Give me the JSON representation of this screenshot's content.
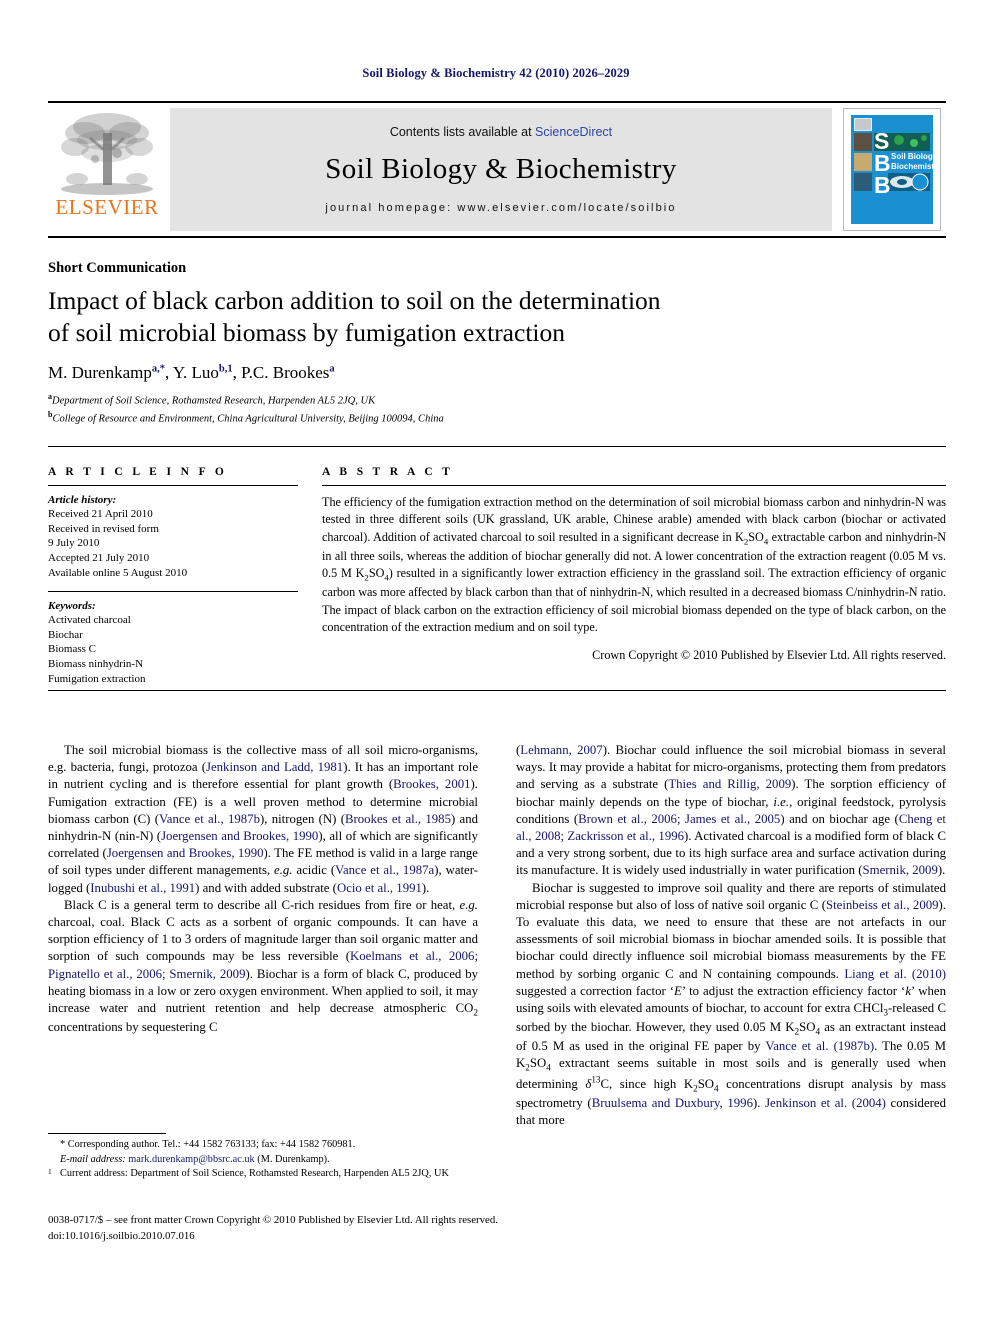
{
  "running_head": "Soil Biology & Biochemistry 42 (2010) 2026–2029",
  "masthead": {
    "publisher_name": "ELSEVIER",
    "publisher_logo": "elsevier-tree-logo",
    "contents_prefix": "Contents lists available at ",
    "contents_link": "ScienceDirect",
    "journal_title": "Soil Biology & Biochemistry",
    "homepage": "journal homepage: www.elsevier.com/locate/soilbio",
    "cover_alt": "SBB journal cover",
    "cover_letters": [
      "S",
      "B",
      "B"
    ],
    "cover_title_line1": "Soil Biology &",
    "cover_title_line2": "Biochemistry",
    "cover_color": "#1a8fd1"
  },
  "article": {
    "category": "Short Communication",
    "title_line1": "Impact of black carbon addition to soil on the determination",
    "title_line2": "of soil microbial biomass by fumigation extraction",
    "authors": [
      {
        "name": "M. Durenkamp",
        "sup": "a,*"
      },
      {
        "name": "Y. Luo",
        "sup": "b,1"
      },
      {
        "name": "P.C. Brookes",
        "sup": "a"
      }
    ],
    "affiliations": [
      {
        "mark": "a",
        "text": "Department of Soil Science, Rothamsted Research, Harpenden AL5 2JQ, UK"
      },
      {
        "mark": "b",
        "text": "College of Resource and Environment, China Agricultural University, Beijing 100094, China"
      }
    ]
  },
  "article_info": {
    "heading": "A R T I C L E   I N F O",
    "history_label": "Article history:",
    "history": [
      "Received 21 April 2010",
      "Received in revised form",
      "9 July 2010",
      "Accepted 21 July 2010",
      "Available online 5 August 2010"
    ],
    "keywords_label": "Keywords:",
    "keywords": [
      "Activated charcoal",
      "Biochar",
      "Biomass C",
      "Biomass ninhydrin-N",
      "Fumigation extraction"
    ]
  },
  "abstract": {
    "heading": "A B S T R A C T",
    "paragraph_parts": [
      "The efficiency of the fumigation extraction method on the determination of soil microbial biomass carbon and ninhydrin-N was tested in three different soils (UK grassland, UK arable, Chinese arable) amended with black carbon (biochar or activated charcoal). Addition of activated charcoal to soil resulted in a significant decrease in K",
      "2",
      "SO",
      "4",
      " extractable carbon and ninhydrin-N in all three soils, whereas the addition of biochar generally did not. A lower concentration of the extraction reagent (0.05 M vs. 0.5 M K",
      "2",
      "SO",
      "4",
      ") resulted in a significantly lower extraction efficiency in the grassland soil. The extraction efficiency of organic carbon was more affected by black carbon than that of ninhydrin-N, which resulted in a decreased biomass C/ninhydrin-N ratio. The impact of black carbon on the extraction efficiency of soil microbial biomass depended on the type of black carbon, on the concentration of the extraction medium and on soil type."
    ],
    "copyright": "Crown Copyright © 2010 Published by Elsevier Ltd. All rights reserved."
  },
  "body": {
    "left_paragraph_1": "The soil microbial biomass is the collective mass of all soil micro-organisms, e.g. bacteria, fungi, protozoa (Jenkinson and Ladd, 1981). It has an important role in nutrient cycling and is therefore essential for plant growth (Brookes, 2001). Fumigation extraction (FE) is a well proven method to determine microbial biomass carbon (C) (Vance et al., 1987b), nitrogen (N) (Brookes et al., 1985) and ninhydrin-N (nin-N) (Joergensen and Brookes, 1990), all of which are significantly correlated (Joergensen and Brookes, 1990). The FE method is valid in a large range of soil types under different managements, e.g. acidic (Vance et al., 1987a), water-logged (Inubushi et al., 1991) and with added substrate (Ocio et al., 1991).",
    "left_paragraph_2": "Black C is a general term to describe all C-rich residues from fire or heat, e.g. charcoal, coal. Black C acts as a sorbent of organic compounds. It can have a sorption efficiency of 1 to 3 orders of magnitude larger than soil organic matter and sorption of such compounds may be less reversible (Koelmans et al., 2006; Pignatello et al., 2006; Smernik, 2009). Biochar is a form of black C, produced by heating biomass in a low or zero oxygen environment. When applied to soil, it may increase water and nutrient retention and help decrease atmospheric CO2 concentrations by sequestering C",
    "right_paragraph_1": "(Lehmann, 2007). Biochar could influence the soil microbial biomass in several ways. It may provide a habitat for micro-organisms, protecting them from predators and serving as a substrate (Thies and Rillig, 2009). The sorption efficiency of biochar mainly depends on the type of biochar, i.e., original feedstock, pyrolysis conditions (Brown et al., 2006; James et al., 2005) and on biochar age (Cheng et al., 2008; Zackrisson et al., 1996). Activated charcoal is a modified form of black C and a very strong sorbent, due to its high surface area and surface activation during its manufacture. It is widely used industrially in water purification (Smernik, 2009).",
    "right_paragraph_2": "Biochar is suggested to improve soil quality and there are reports of stimulated microbial response but also of loss of native soil organic C (Steinbeiss et al., 2009). To evaluate this data, we need to ensure that these are not artefacts in our assessments of soil microbial biomass in biochar amended soils. It is possible that biochar could directly influence soil microbial biomass measurements by the FE method by sorbing organic C and N containing compounds. Liang et al. (2010) suggested a correction factor 'E' to adjust the extraction efficiency factor 'k' when using soils with elevated amounts of biochar, to account for extra CHCl3-released C sorbed by the biochar. However, they used 0.05 M K2SO4 as an extractant instead of 0.5 M as used in the original FE paper by Vance et al. (1987b). The 0.05 M K2SO4 extractant seems suitable in most soils and is generally used when determining δ13C, since high K2SO4 concentrations disrupt analysis by mass spectrometry (Bruulsema and Duxbury, 1996). Jenkinson et al. (2004) considered that more"
  },
  "footnotes": {
    "corresponding": "* Corresponding author. Tel.: +44 1582 763133; fax: +44 1582 760981.",
    "email_label": "E-mail address:",
    "email": "mark.durenkamp@bbsrc.ac.uk",
    "email_suffix": "(M. Durenkamp).",
    "current_address_mark": "1",
    "current_address": "Current address: Department of Soil Science, Rothamsted Research, Harpenden AL5 2JQ, UK"
  },
  "imprint": {
    "line1": "0038-0717/$ – see front matter Crown Copyright © 2010 Published by Elsevier Ltd. All rights reserved.",
    "line2_label": "doi:",
    "line2_value": "10.1016/j.soilbio.2010.07.016"
  },
  "colors": {
    "link": "#15156b",
    "sciencedirect": "#2b44a8",
    "elsevier_orange": "#e8751a",
    "band_gray": "#e3e3e3"
  }
}
